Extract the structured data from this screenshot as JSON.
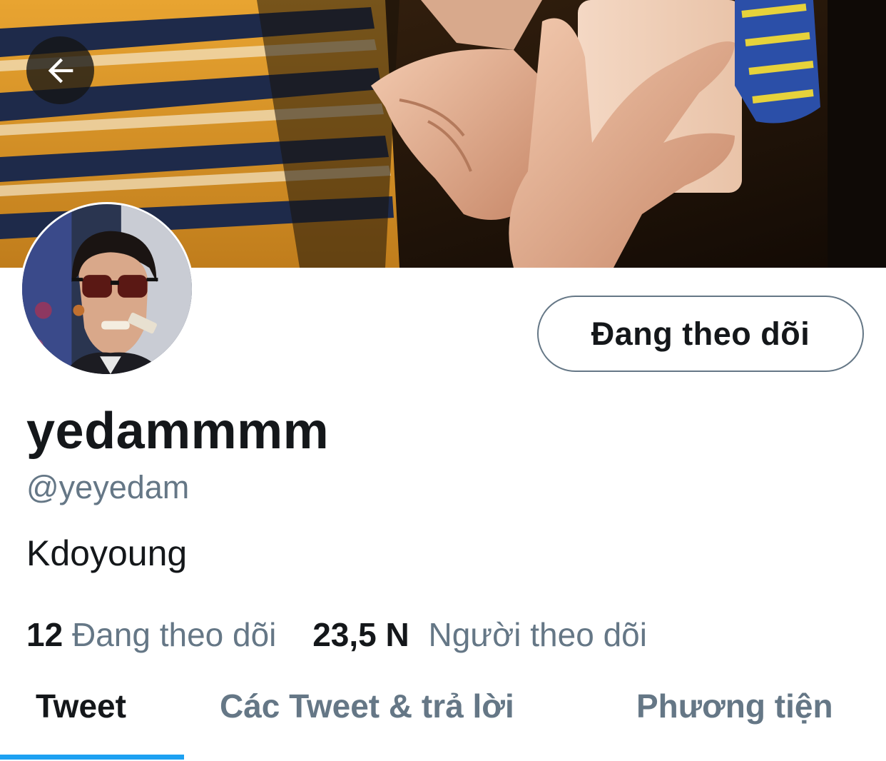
{
  "header": {
    "back_icon": "arrow-left-icon"
  },
  "profile": {
    "follow_button_label": "Đang theo dõi",
    "display_name": "yedammmm",
    "handle": "@yeyedam",
    "bio": "Kdoyoung",
    "stats": {
      "following_count": "12",
      "following_label": "Đang theo dõi",
      "followers_count": "23,5 N",
      "followers_label": "Người theo dõi"
    }
  },
  "tabs": [
    {
      "label": "Tweet",
      "active": true
    },
    {
      "label": "Các Tweet & trả lời",
      "active": false
    },
    {
      "label": "Phương tiện",
      "active": false
    }
  ],
  "colors": {
    "text_primary": "#14171a",
    "text_secondary": "#657786",
    "accent": "#1da1f2"
  }
}
